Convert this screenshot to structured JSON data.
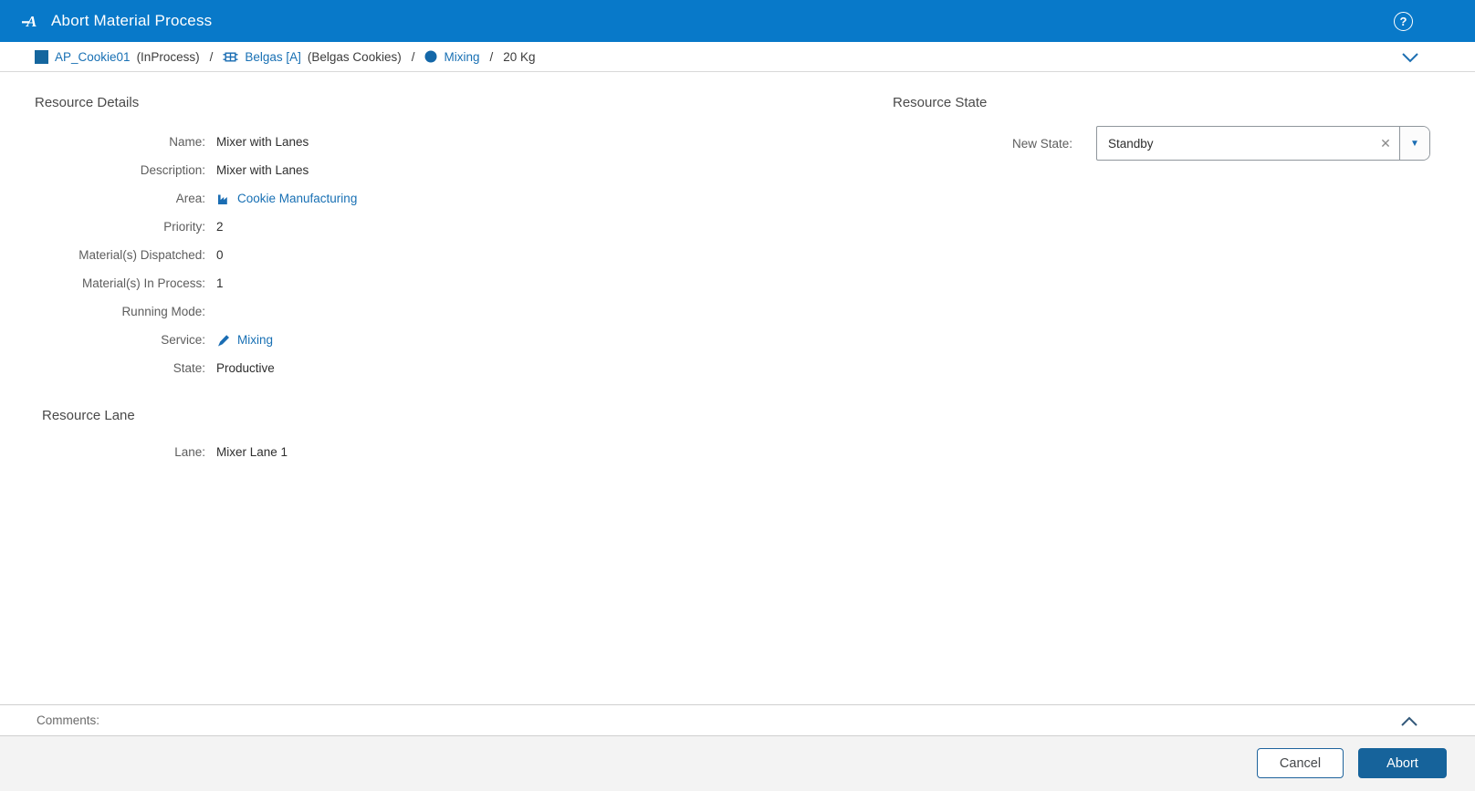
{
  "header": {
    "title": "Abort Material Process"
  },
  "icons": {
    "help": "?",
    "clear": "✕",
    "dropdown": "▼"
  },
  "breadcrumb": {
    "separator": "/",
    "items": [
      {
        "icon": "lot-square-icon",
        "label": "AP_Cookie01",
        "annotation": "(InProcess)"
      },
      {
        "icon": "product-grid-icon",
        "label": "Belgas [A]",
        "annotation": "(Belgas Cookies)"
      },
      {
        "icon": "step-circle-icon",
        "label": "Mixing",
        "annotation": ""
      },
      {
        "icon": "",
        "label": "20 Kg",
        "annotation": ""
      }
    ]
  },
  "resource_details": {
    "title": "Resource Details",
    "fields": [
      {
        "label": "Name:",
        "value": "Mixer with Lanes"
      },
      {
        "label": "Description:",
        "value": "Mixer with Lanes"
      },
      {
        "label": "Area:",
        "value": "Cookie Manufacturing",
        "icon": "factory-icon",
        "link": true
      },
      {
        "label": "Priority:",
        "value": "2"
      },
      {
        "label": "Material(s) Dispatched:",
        "value": "0"
      },
      {
        "label": "Material(s) In Process:",
        "value": "1"
      },
      {
        "label": "Running Mode:",
        "value": ""
      },
      {
        "label": "Service:",
        "value": "Mixing",
        "icon": "service-pen-icon",
        "link": true
      },
      {
        "label": "State:",
        "value": "Productive"
      }
    ]
  },
  "resource_state": {
    "title": "Resource State",
    "field_label": "New State:",
    "value": "Standby"
  },
  "resource_lane": {
    "title": "Resource Lane",
    "fields": [
      {
        "label": "Lane:",
        "value": "Mixer Lane 1"
      }
    ]
  },
  "comments": {
    "label": "Comments:"
  },
  "footer": {
    "cancel_label": "Cancel",
    "abort_label": "Abort"
  },
  "colors": {
    "topbar_blue": "#0879C9",
    "link_blue": "#1870B4",
    "icon_blue": "#1A6DB3",
    "abort_button_blue": "#16639B",
    "footer_gray": "#F3F3F3"
  }
}
